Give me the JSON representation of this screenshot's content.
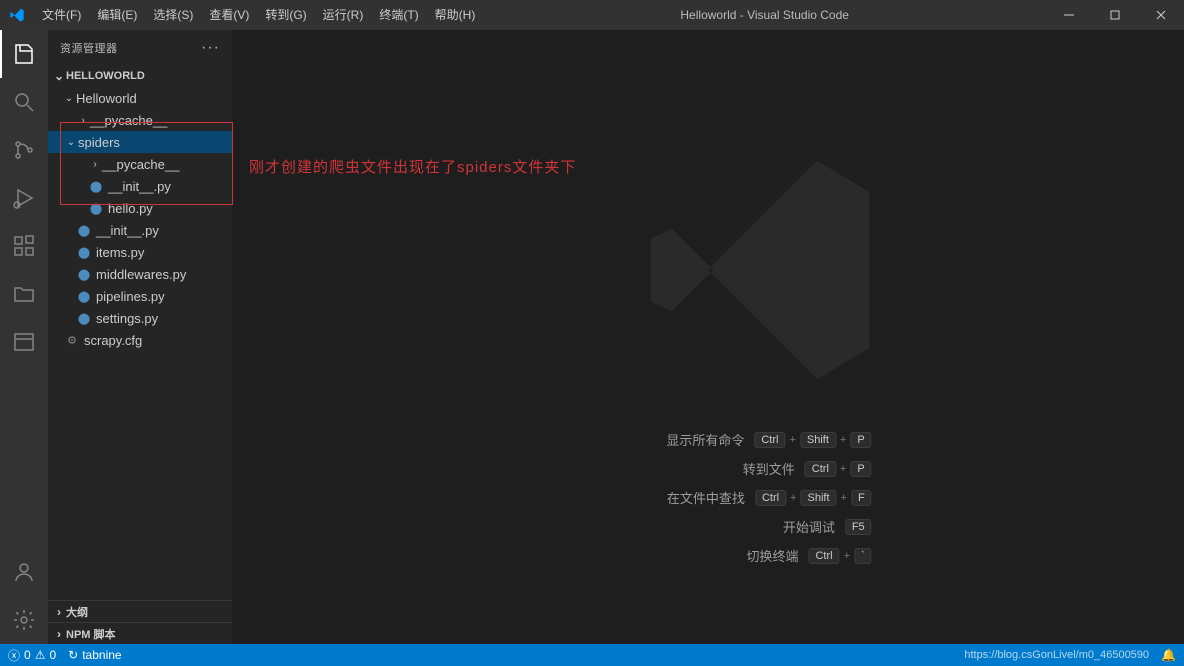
{
  "titlebar": {
    "menus": [
      "文件(F)",
      "编辑(E)",
      "选择(S)",
      "查看(V)",
      "转到(G)",
      "运行(R)",
      "终端(T)",
      "帮助(H)"
    ],
    "title": "Helloworld - Visual Studio Code"
  },
  "sidebar": {
    "headerTitle": "资源管理器"
  },
  "explorer": {
    "root": "HELLOWORLD",
    "tree": {
      "helloworld": "Helloworld",
      "pycache1": "__pycache__",
      "spiders": "spiders",
      "pycache2": "__pycache__",
      "init_spiders": "__init__.py",
      "hello": "hello.py",
      "init_root": "__init__.py",
      "items": "items.py",
      "middlewares": "middlewares.py",
      "pipelines": "pipelines.py",
      "settings": "settings.py",
      "scrapycfg": "scrapy.cfg"
    },
    "outline": "大纲",
    "npmScripts": "NPM 脚本"
  },
  "annotation": {
    "text": "刚才创建的爬虫文件出现在了spiders文件夹下"
  },
  "watermark": {
    "rows": [
      {
        "label": "显示所有命令",
        "keys": [
          "Ctrl",
          "Shift",
          "P"
        ]
      },
      {
        "label": "转到文件",
        "keys": [
          "Ctrl",
          "P"
        ]
      },
      {
        "label": "在文件中查找",
        "keys": [
          "Ctrl",
          "Shift",
          "F"
        ]
      },
      {
        "label": "开始调试",
        "keys": [
          "F5"
        ]
      },
      {
        "label": "切换终端",
        "keys": [
          "Ctrl",
          "`"
        ]
      }
    ]
  },
  "statusbar": {
    "errors": "0",
    "warnings": "0",
    "tabnine": "tabnine",
    "rightWatermark": "https://blog.csGonLivel/m0_46500590",
    "feedbackIcon": "☺"
  },
  "icons": {
    "python": "🐍",
    "cfg": "⚙",
    "search": "🔍"
  }
}
